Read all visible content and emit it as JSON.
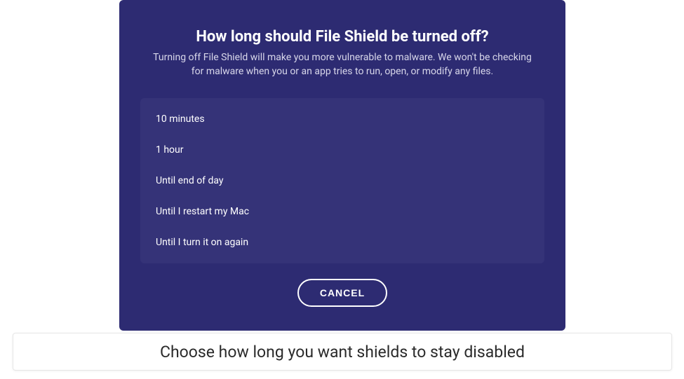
{
  "dialog": {
    "title": "How long should File Shield be turned off?",
    "subtitle": "Turning off File Shield will make you more vulnerable to malware. We won't be checking for malware when you or an app tries to run, open, or modify any files.",
    "options": [
      "10 minutes",
      "1 hour",
      "Until end of day",
      "Until I restart my Mac",
      "Until I turn it on again"
    ],
    "cancel_label": "CANCEL"
  },
  "caption": "Choose how long you want shields to stay disabled"
}
